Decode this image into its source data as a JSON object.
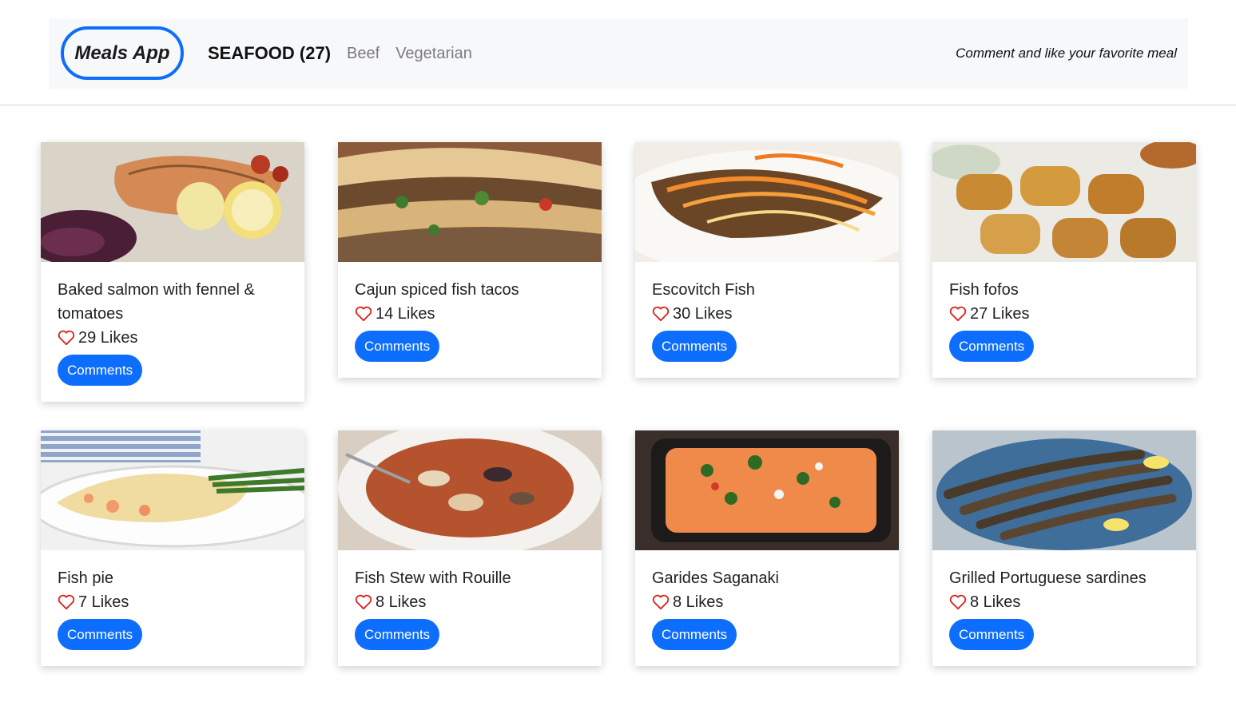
{
  "header": {
    "brand": "Meals App",
    "nav": [
      {
        "label": "SEAFOOD (27)",
        "active": true
      },
      {
        "label": "Beef",
        "active": false
      },
      {
        "label": "Vegetarian",
        "active": false
      }
    ],
    "tagline": "Comment and like your favorite meal"
  },
  "colors": {
    "accent": "#0d6efd",
    "heart": "#e02020",
    "navbar_bg": "#f7f8fa"
  },
  "meals": [
    {
      "title": "Baked salmon with fennel & tomatoes",
      "likes": "29 Likes",
      "button": "Comments",
      "image": "salmon-photo"
    },
    {
      "title": "Cajun spiced fish tacos",
      "likes": "14 Likes",
      "button": "Comments",
      "image": "tacos-photo"
    },
    {
      "title": "Escovitch Fish",
      "likes": "30 Likes",
      "button": "Comments",
      "image": "escovitch-photo"
    },
    {
      "title": "Fish fofos",
      "likes": "27 Likes",
      "button": "Comments",
      "image": "fofos-photo"
    },
    {
      "title": "Fish pie",
      "likes": "7 Likes",
      "button": "Comments",
      "image": "fish-pie-photo"
    },
    {
      "title": "Fish Stew with Rouille",
      "likes": "8 Likes",
      "button": "Comments",
      "image": "fish-stew-photo"
    },
    {
      "title": "Garides Saganaki",
      "likes": "8 Likes",
      "button": "Comments",
      "image": "saganaki-photo"
    },
    {
      "title": "Grilled Portuguese sardines",
      "likes": "8 Likes",
      "button": "Comments",
      "image": "sardines-photo"
    }
  ]
}
